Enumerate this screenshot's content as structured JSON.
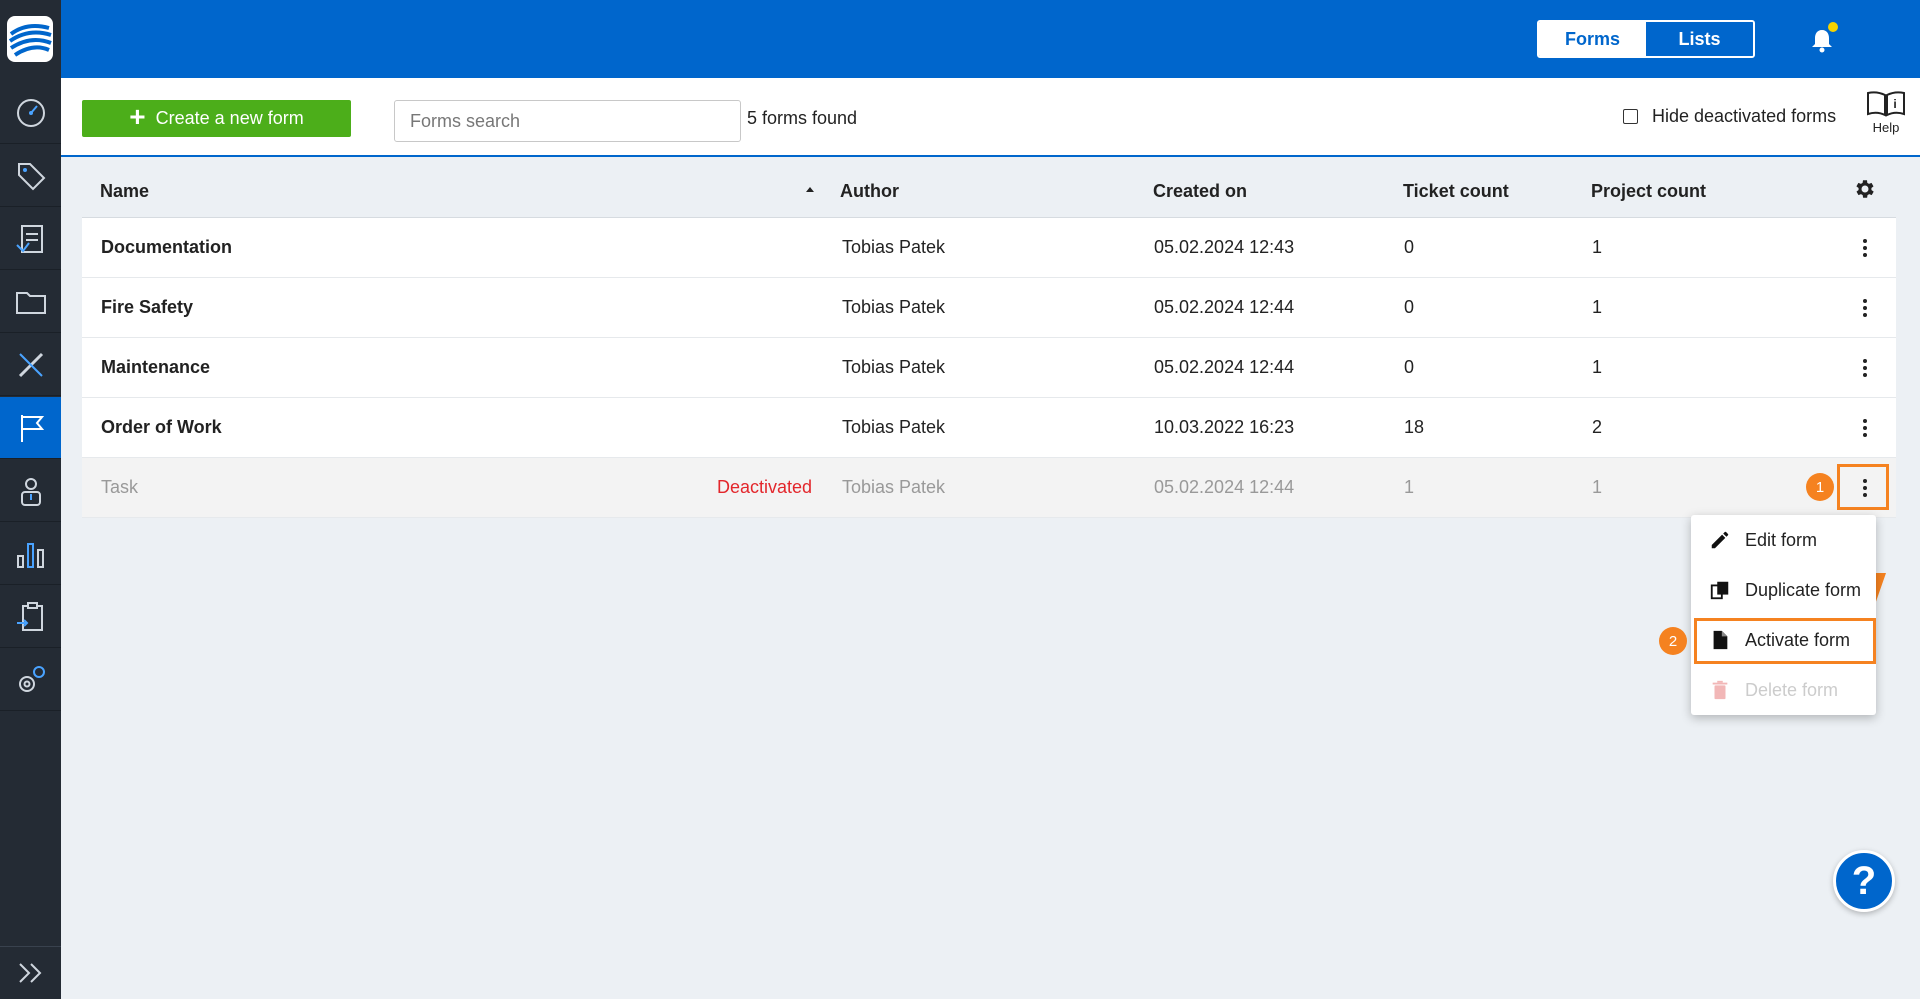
{
  "header": {
    "tabs": [
      {
        "label": "Forms",
        "active": true
      },
      {
        "label": "Lists",
        "active": false
      }
    ]
  },
  "toolbar": {
    "create_label": "Create a new form",
    "search_placeholder": "Forms search",
    "found_text": "5 forms found",
    "hide_deactivated_label": "Hide deactivated forms",
    "hide_deactivated_checked": false,
    "help_label": "Help"
  },
  "table": {
    "columns": [
      "Name",
      "Author",
      "Created on",
      "Ticket count",
      "Project count"
    ],
    "rows": [
      {
        "name": "Documentation",
        "status": "",
        "author": "Tobias Patek",
        "created": "05.02.2024 12:43",
        "tickets": "0",
        "projects": "1"
      },
      {
        "name": "Fire Safety",
        "status": "",
        "author": "Tobias Patek",
        "created": "05.02.2024 12:44",
        "tickets": "0",
        "projects": "1"
      },
      {
        "name": "Maintenance",
        "status": "",
        "author": "Tobias Patek",
        "created": "05.02.2024 12:44",
        "tickets": "0",
        "projects": "1"
      },
      {
        "name": "Order of Work",
        "status": "",
        "author": "Tobias Patek",
        "created": "10.03.2022 16:23",
        "tickets": "18",
        "projects": "2"
      },
      {
        "name": "Task",
        "status": "Deactivated",
        "author": "Tobias Patek",
        "created": "05.02.2024 12:44",
        "tickets": "1",
        "projects": "1"
      }
    ]
  },
  "menu": {
    "items": [
      {
        "label": "Edit form",
        "icon": "pencil-icon",
        "disabled": false
      },
      {
        "label": "Duplicate form",
        "icon": "copy-icon",
        "disabled": false
      },
      {
        "label": "Activate form",
        "icon": "file-icon",
        "disabled": false
      },
      {
        "label": "Delete form",
        "icon": "trash-icon",
        "disabled": true
      }
    ]
  },
  "annotations": {
    "step1": "1",
    "step2": "2"
  },
  "colors": {
    "primary": "#0066cc",
    "create": "#4cae1a",
    "highlight": "#f58220",
    "deactivated": "#e3262b",
    "sidebar": "#242b34"
  },
  "sidebar": {
    "items": [
      "dashboard-icon",
      "tags-icon",
      "reports-icon",
      "folder-icon",
      "tools-icon",
      "forms-flag-icon",
      "user-icon",
      "statistics-icon",
      "clipboard-icon",
      "settings-icon"
    ],
    "active": "forms-flag-icon"
  },
  "help_fab": "?"
}
